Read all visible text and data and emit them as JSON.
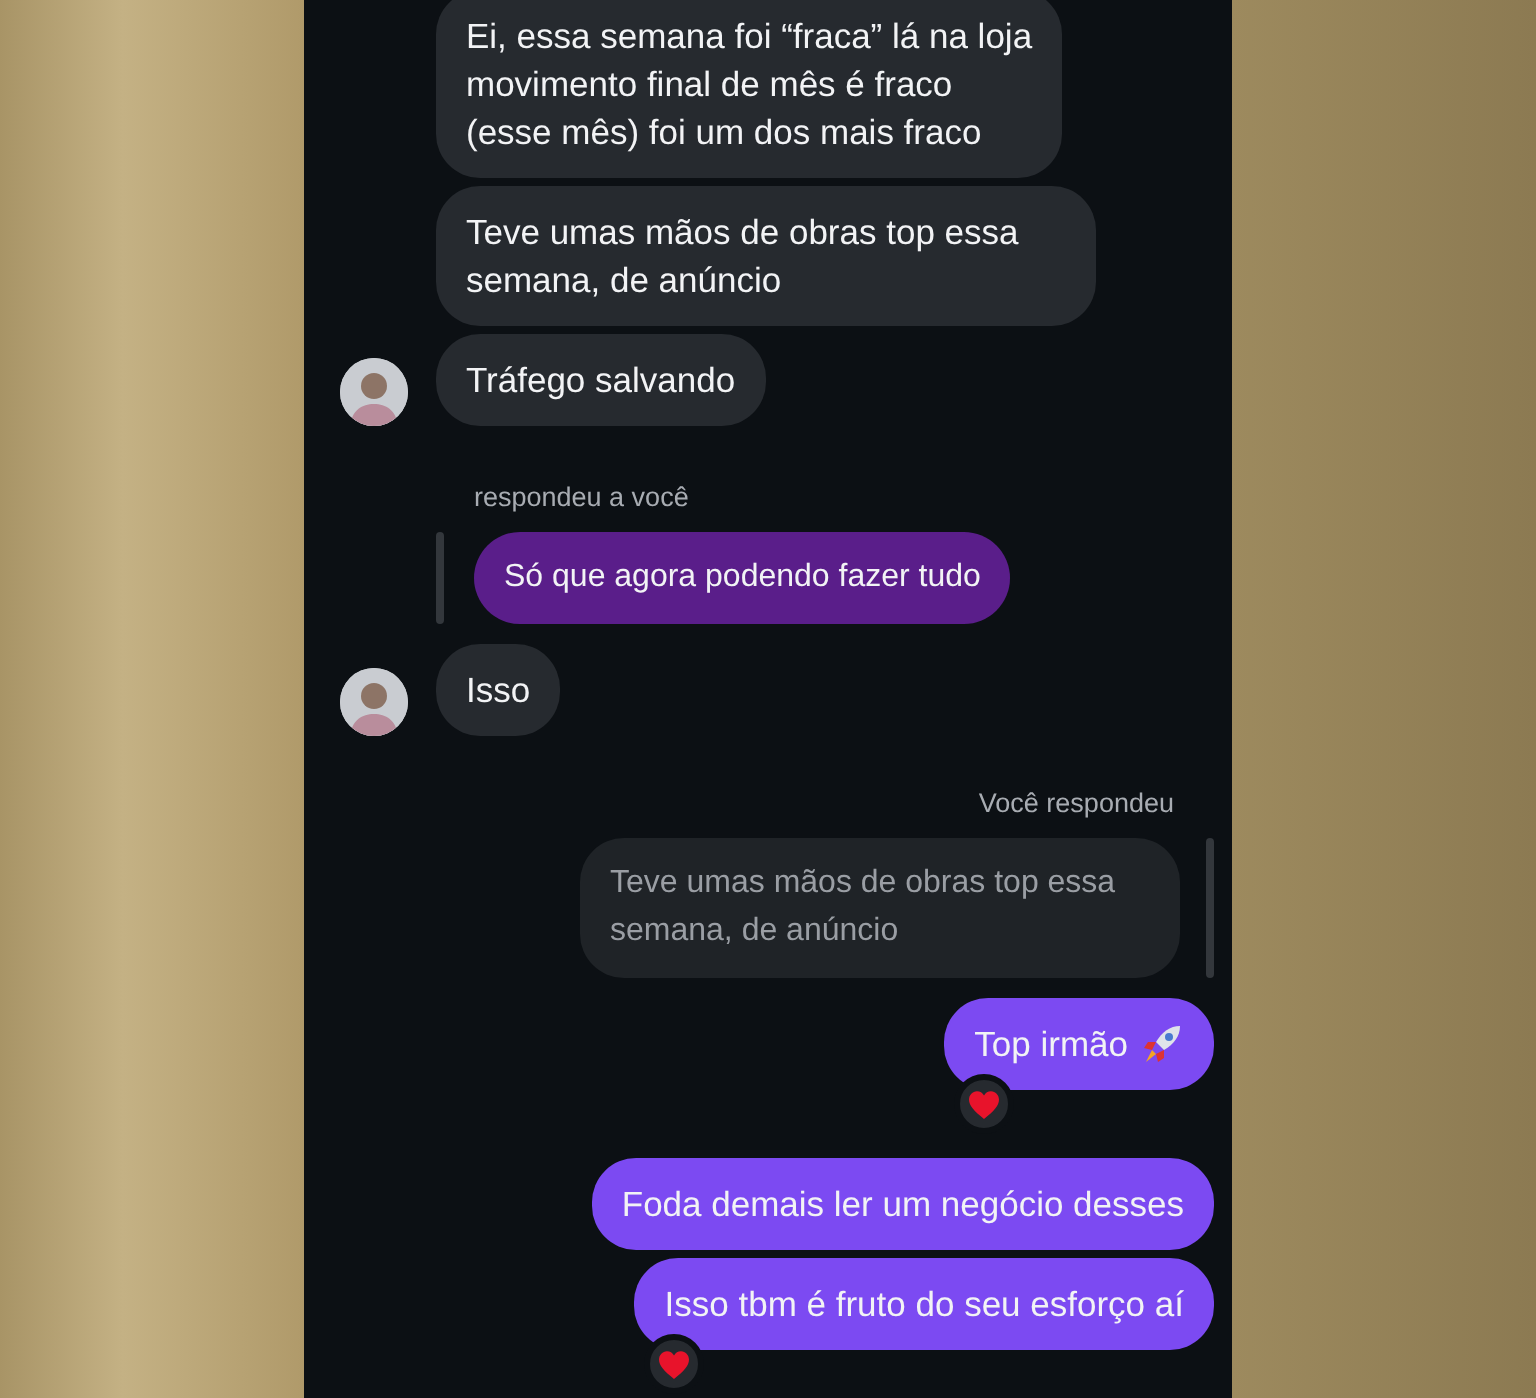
{
  "messages": [
    {
      "kind": "received",
      "text": "Ei, essa semana foi “fraca” lá na loja\nmovimento final de mês é fraco\n(esse mês) foi um dos mais fraco",
      "avatar": false
    },
    {
      "kind": "received",
      "text": "Teve umas mãos de obras top essa semana, de anúncio",
      "avatar": false
    },
    {
      "kind": "received",
      "text": "Tráfego salvando",
      "avatar": true
    },
    {
      "kind": "label_in",
      "text": "respondeu a você"
    },
    {
      "kind": "quote_in",
      "text": "Só que agora podendo fazer tudo"
    },
    {
      "kind": "received",
      "text": "Isso",
      "avatar": true
    },
    {
      "kind": "label_out",
      "text": "Você respondeu"
    },
    {
      "kind": "quote_out",
      "text": "Teve umas mãos de obras top essa semana, de anúncio"
    },
    {
      "kind": "sent",
      "text": "Top irmão",
      "trailing_icon": true,
      "reacted": true
    },
    {
      "kind": "sent",
      "text": "Foda demais ler um negócio desses",
      "trailing_icon": false,
      "reacted": false
    },
    {
      "kind": "sent",
      "text": "Isso tbm é fruto do seu esforço aí",
      "trailing_icon": false,
      "reacted": true
    }
  ]
}
